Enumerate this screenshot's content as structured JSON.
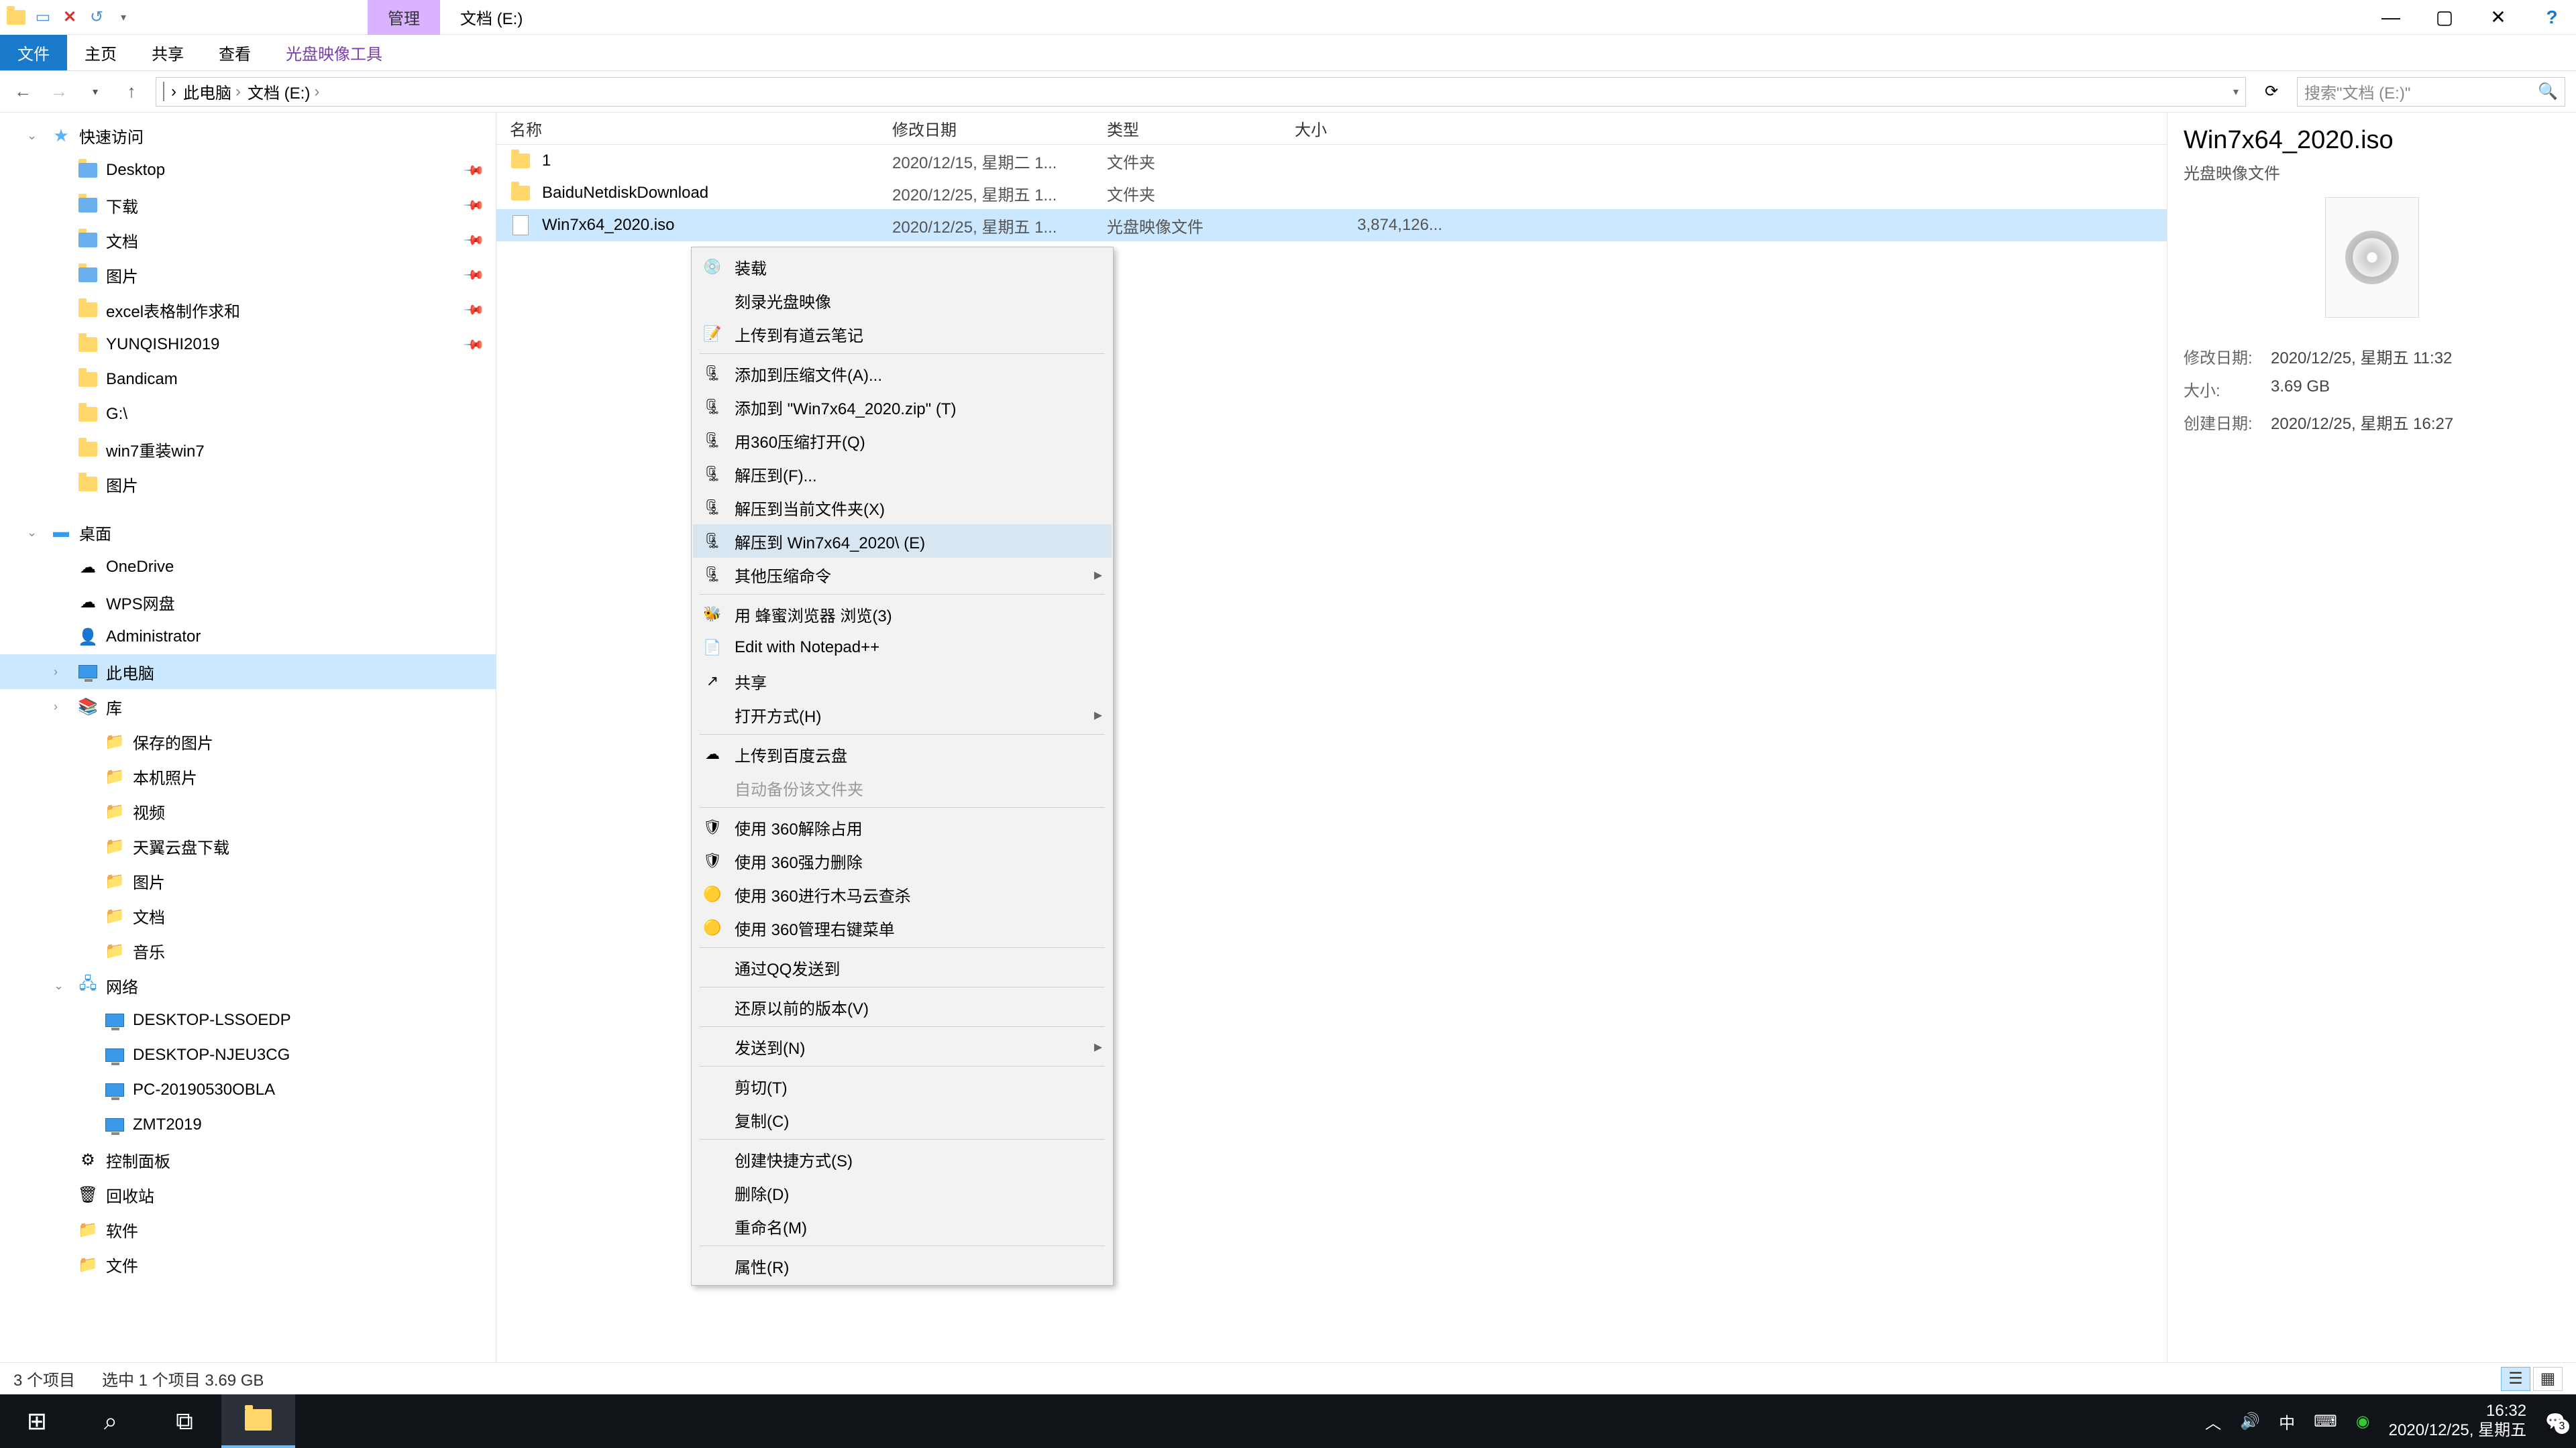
{
  "titlebar": {
    "contextual_tab": "管理",
    "title": "文档 (E:)"
  },
  "ribbon": {
    "tabs": [
      "文件",
      "主页",
      "共享",
      "查看",
      "光盘映像工具"
    ]
  },
  "address": {
    "crumbs": [
      "此电脑",
      "文档 (E:)"
    ],
    "search_placeholder": "搜索\"文档 (E:)\""
  },
  "tree": {
    "quick_access": "快速访问",
    "quick_items": [
      "Desktop",
      "下载",
      "文档",
      "图片",
      "excel表格制作求和",
      "YUNQISHI2019",
      "Bandicam",
      "G:\\",
      "win7重装win7",
      "图片"
    ],
    "desktop_root": "桌面",
    "desktop_items": [
      "OneDrive",
      "WPS网盘",
      "Administrator",
      "此电脑",
      "库"
    ],
    "library_items": [
      "保存的图片",
      "本机照片",
      "视频",
      "天翼云盘下载",
      "图片",
      "文档",
      "音乐"
    ],
    "network": "网络",
    "network_items": [
      "DESKTOP-LSSOEDP",
      "DESKTOP-NJEU3CG",
      "PC-20190530OBLA",
      "ZMT2019"
    ],
    "tail_items": [
      "控制面板",
      "回收站",
      "软件",
      "文件"
    ]
  },
  "columns": {
    "name": "名称",
    "date": "修改日期",
    "type": "类型",
    "size": "大小"
  },
  "files": [
    {
      "name": "1",
      "date": "2020/12/15, 星期二 1...",
      "type": "文件夹",
      "size": "",
      "kind": "folder"
    },
    {
      "name": "BaiduNetdiskDownload",
      "date": "2020/12/25, 星期五 1...",
      "type": "文件夹",
      "size": "",
      "kind": "folder"
    },
    {
      "name": "Win7x64_2020.iso",
      "date": "2020/12/25, 星期五 1...",
      "type": "光盘映像文件",
      "size": "3,874,126...",
      "kind": "iso"
    }
  ],
  "context_menu": {
    "groups": [
      [
        {
          "label": "装载",
          "icon": "disc"
        },
        {
          "label": "刻录光盘映像",
          "icon": ""
        },
        {
          "label": "上传到有道云笔记",
          "icon": "note"
        }
      ],
      [
        {
          "label": "添加到压缩文件(A)...",
          "icon": "archive"
        },
        {
          "label": "添加到 \"Win7x64_2020.zip\" (T)",
          "icon": "archive"
        },
        {
          "label": "用360压缩打开(Q)",
          "icon": "archive"
        },
        {
          "label": "解压到(F)...",
          "icon": "archive"
        },
        {
          "label": "解压到当前文件夹(X)",
          "icon": "archive"
        },
        {
          "label": "解压到 Win7x64_2020\\ (E)",
          "icon": "archive",
          "hovered": true
        },
        {
          "label": "其他压缩命令",
          "icon": "archive",
          "submenu": true
        }
      ],
      [
        {
          "label": "用 蜂蜜浏览器 浏览(3)",
          "icon": "bee"
        },
        {
          "label": "Edit with Notepad++",
          "icon": "npp"
        },
        {
          "label": "共享",
          "icon": "share"
        },
        {
          "label": "打开方式(H)",
          "icon": "",
          "submenu": true
        }
      ],
      [
        {
          "label": "上传到百度云盘",
          "icon": "cloud"
        },
        {
          "label": "自动备份该文件夹",
          "icon": "",
          "disabled": true
        }
      ],
      [
        {
          "label": "使用 360解除占用",
          "icon": "360"
        },
        {
          "label": "使用 360强力删除",
          "icon": "360"
        },
        {
          "label": "使用 360进行木马云查杀",
          "icon": "360y"
        },
        {
          "label": "使用 360管理右键菜单",
          "icon": "360y"
        }
      ],
      [
        {
          "label": "通过QQ发送到",
          "icon": ""
        }
      ],
      [
        {
          "label": "还原以前的版本(V)",
          "icon": ""
        }
      ],
      [
        {
          "label": "发送到(N)",
          "icon": "",
          "submenu": true
        }
      ],
      [
        {
          "label": "剪切(T)",
          "icon": ""
        },
        {
          "label": "复制(C)",
          "icon": ""
        }
      ],
      [
        {
          "label": "创建快捷方式(S)",
          "icon": ""
        },
        {
          "label": "删除(D)",
          "icon": ""
        },
        {
          "label": "重命名(M)",
          "icon": ""
        }
      ],
      [
        {
          "label": "属性(R)",
          "icon": ""
        }
      ]
    ]
  },
  "details": {
    "name": "Win7x64_2020.iso",
    "type": "光盘映像文件",
    "meta": {
      "mod_k": "修改日期:",
      "mod_v": "2020/12/25, 星期五 11:32",
      "size_k": "大小:",
      "size_v": "3.69 GB",
      "create_k": "创建日期:",
      "create_v": "2020/12/25, 星期五 16:27"
    }
  },
  "status": {
    "count": "3 个项目",
    "selection": "选中 1 个项目  3.69 GB"
  },
  "taskbar": {
    "time": "16:32",
    "date": "2020/12/25, 星期五",
    "ime": "中",
    "badge": "3"
  }
}
